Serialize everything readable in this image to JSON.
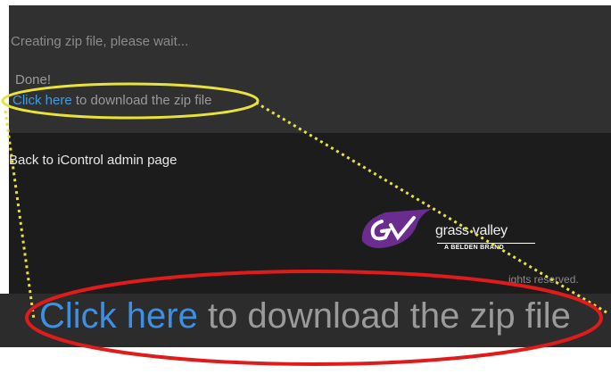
{
  "status": {
    "creating": "Creating zip file, please wait...",
    "done": "Done!",
    "link_label": "Click here",
    "link_suffix": " to download the zip file"
  },
  "back_link": "Back to iControl admin page",
  "brand": {
    "name": "grass valley",
    "tagline": "A BELDEN BRAND",
    "copyright_fragment": "ights reserved."
  },
  "zoom_callout": {
    "link_label": "Click here",
    "suffix": " to download the zip file"
  },
  "colors": {
    "link": "#3f9ce6",
    "highlight_ellipse": "#e8e23a",
    "zoom_ellipse": "#e01b1b",
    "logo_purple": "#6b2c8f"
  }
}
